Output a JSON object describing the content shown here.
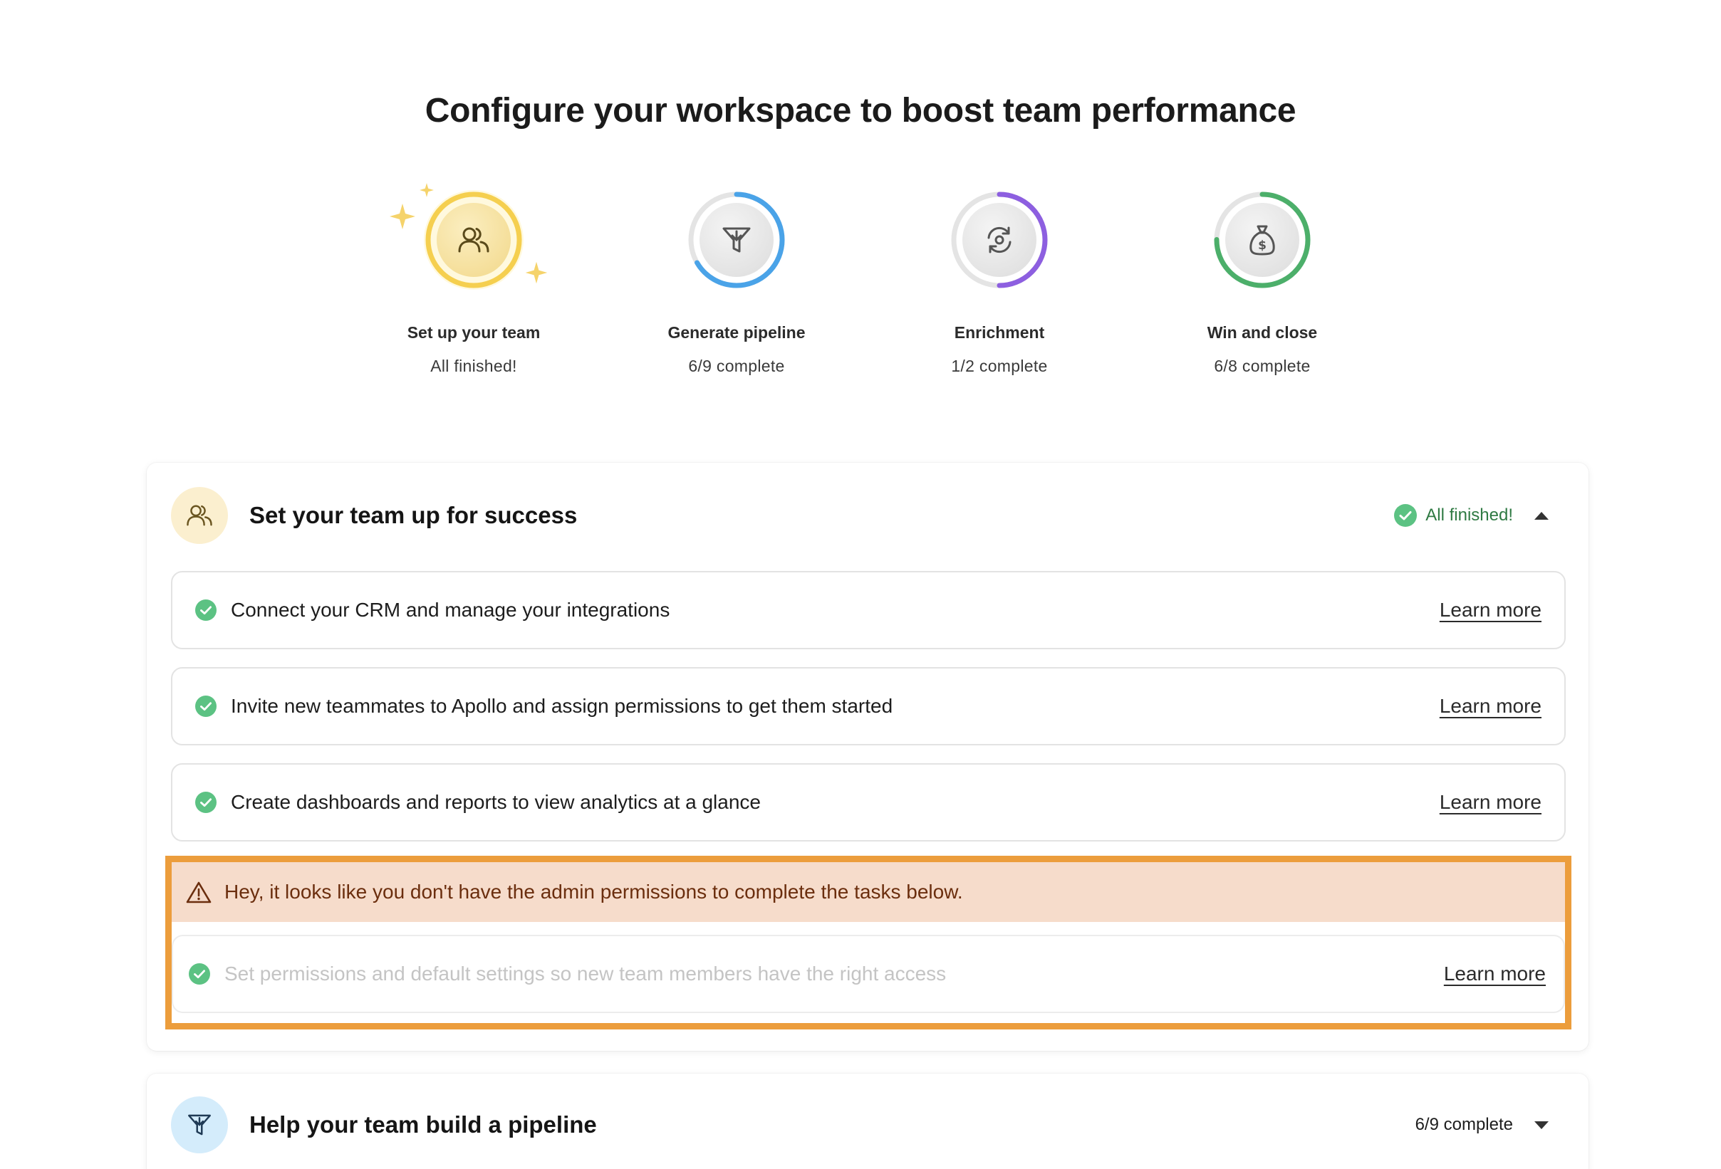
{
  "page": {
    "title": "Configure your workspace to boost team performance"
  },
  "steps": [
    {
      "label": "Set up your team",
      "status": "All finished!",
      "icon": "team-icon",
      "color": "#f5cf4f",
      "progress": 1.0
    },
    {
      "label": "Generate pipeline",
      "status": "6/9 complete",
      "icon": "funnel-icon",
      "color": "#4aa3e8",
      "progress": 0.667
    },
    {
      "label": "Enrichment",
      "status": "1/2 complete",
      "icon": "refresh-icon",
      "color": "#8d5fe0",
      "progress": 0.5
    },
    {
      "label": "Win and close",
      "status": "6/8 complete",
      "icon": "money-bag-icon",
      "color": "#4caf6a",
      "progress": 0.75
    }
  ],
  "sections": [
    {
      "title": "Set your team up for success",
      "status": "All finished!",
      "expanded": true,
      "tasks": [
        {
          "text": "Connect your CRM and manage your integrations",
          "link": "Learn more"
        },
        {
          "text": "Invite new teammates to Apollo and assign permissions to get them started",
          "link": "Learn more"
        },
        {
          "text": "Create dashboards and reports to view analytics at a glance",
          "link": "Learn more"
        }
      ],
      "warning": {
        "text": "Hey, it looks like you don't have the admin permissions to complete the tasks below.",
        "task": {
          "text": "Set permissions and default settings so new team members have the right access",
          "link": "Learn more"
        }
      }
    },
    {
      "title": "Help your team build a pipeline",
      "status": "6/9 complete",
      "expanded": false
    }
  ],
  "colors": {
    "success": "#5cc283",
    "warning_border": "#ec9d3c",
    "warning_bg": "#f6dccb"
  }
}
